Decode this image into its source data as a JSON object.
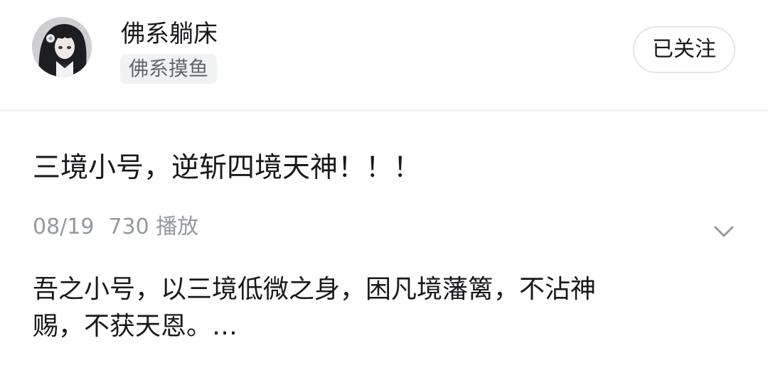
{
  "user": {
    "name": "佛系躺床",
    "tag": "佛系摸鱼",
    "follow_label": "已关注"
  },
  "post": {
    "title": "三境小号，逆斩四境天神！！！",
    "date": "08/19",
    "plays": "730 播放",
    "description_line1": "吾之小号，以三境低微之身，困凡境藩篱，不沾神",
    "description_line2": "赐，不获天恩。…"
  },
  "icons": {
    "expand": "chevron-down-icon"
  },
  "colors": {
    "text_primary": "#18191c",
    "text_secondary": "#9499a0",
    "tag_bg": "#f1f2f3",
    "divider": "#f4f5f7",
    "button_border": "#e3e5e7"
  }
}
